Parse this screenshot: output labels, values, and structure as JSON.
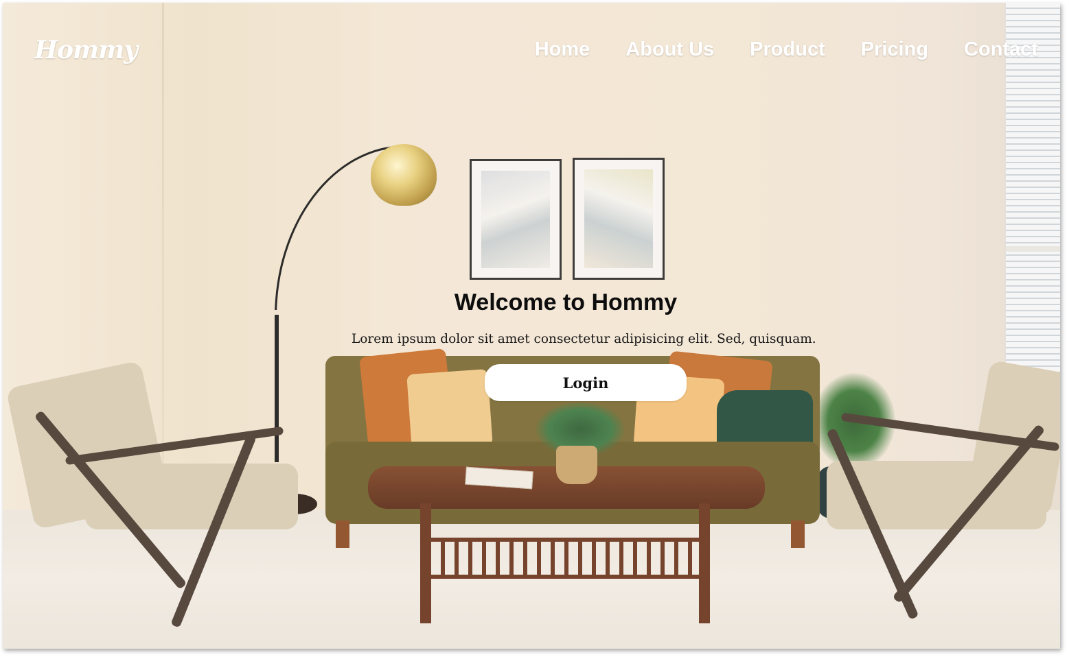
{
  "brand": {
    "logo_text": "Hommy"
  },
  "nav": {
    "items": [
      {
        "label": "Home"
      },
      {
        "label": "About Us"
      },
      {
        "label": "Product"
      },
      {
        "label": "Pricing"
      },
      {
        "label": "Contact"
      }
    ]
  },
  "hero": {
    "title": "Welcome to Hommy",
    "text": "Lorem ipsum dolor sit amet consectetur adipisicing elit. Sed, quisquam.",
    "login_label": "Login",
    "background": "living-room-photo"
  },
  "colors": {
    "nav_text": "#ffffff",
    "title_text": "#0d0d0d",
    "button_bg": "#ffffff"
  }
}
